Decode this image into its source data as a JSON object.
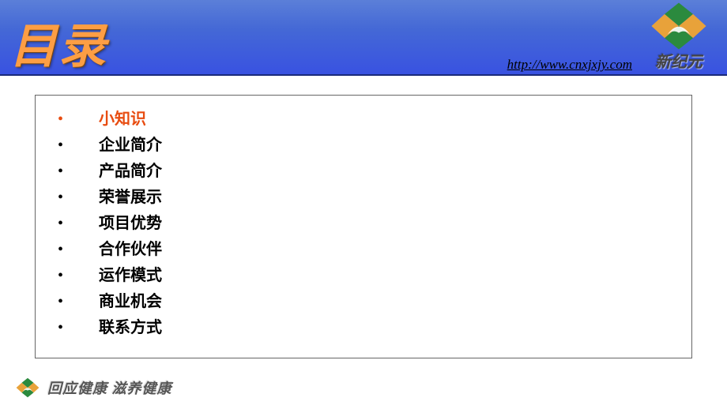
{
  "header": {
    "title": "目录",
    "url": "http://www.cnxjxjy.com",
    "logo_text": "新纪元"
  },
  "toc": {
    "active_index": 0,
    "items": [
      "小知识",
      "企业简介",
      "产品简介",
      "荣誉展示",
      "项目优势",
      "合作伙伴",
      "运作模式",
      "商业机会",
      "联系方式"
    ]
  },
  "footer": {
    "slogan": "回应健康 滋养健康"
  },
  "colors": {
    "header_blue": "#4064d8",
    "accent_red": "#e84c10",
    "title_orange": "#fd9e44"
  }
}
